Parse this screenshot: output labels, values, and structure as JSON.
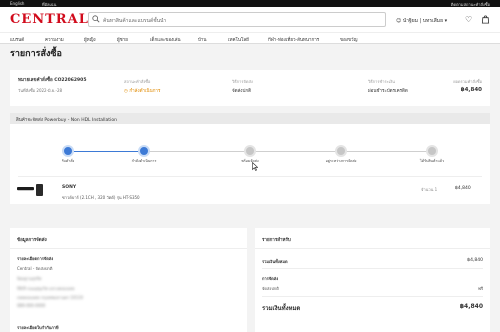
{
  "topbar": {
    "language": "English",
    "store_selector": "ที่อัลเฉน",
    "track_order": "ติดตามสถานะคำสั่งซื้อ"
  },
  "header": {
    "logo": "CENTRAL",
    "search_placeholder": "ค้นหาสินค้าและแบรนด์ชั้นนำ",
    "user_label": "นำฐิยม | บทรเสีมย"
  },
  "nav": {
    "items": [
      "แบรนด์",
      "ความงาม",
      "ผู้หญิง",
      "ผู้ชาย",
      "เด็กและของเล่น",
      "บ้าน",
      "เทคโนโลยี",
      "กีฬา-ท่องเที่ยว-สันทนาการ",
      "ของขวัญ"
    ]
  },
  "page_title": "รายการสั่งซื้อ",
  "order": {
    "number_label": "หมายเลขคำสั่งซื้อ CO22062905",
    "date": "วันที่สั่งซื้อ 2022-มิ.ย.-28",
    "status_label": "สถานะคำสั่งซื้อ",
    "status": "กำลังดำเนินการ",
    "delivery_label": "วิธีการจัดส่ง",
    "delivery": "จัดส่งปกติ",
    "payment_label": "วิธีการชำระเงิน",
    "payment": "ผ่อนชำระบัตรเครดิต",
    "total_label": "ยอดรวมคำสั่งซื้อ",
    "total": "฿4,840"
  },
  "shipment": {
    "banner": "สินค้าจะจัดส่ง Powerbuy - Non HDL Installation",
    "steps": [
      {
        "label": "รับคำสั่ง",
        "state": "done"
      },
      {
        "label": "กำลังดำเนินการ",
        "state": "done"
      },
      {
        "label": "พร้อมจัดส่ง",
        "state": "todo"
      },
      {
        "label": "อยู่ระหว่างการจัดส่ง",
        "state": "todo"
      },
      {
        "label": "ได้รับสินค้าแล้ว",
        "state": "todo"
      }
    ],
    "colors": {
      "done": "#3d7ad6",
      "todo": "#c6c6c6"
    }
  },
  "product": {
    "brand": "SONY",
    "name": "ซาวด์บาร์ (2.1CH , 320 วัตต์) รุ่น HT-S350",
    "quantity": "จำนวน 1",
    "price": "฿4,840"
  },
  "shipping_info": {
    "title": "ข้อมูลการจัดส่ง",
    "method_label": "รายละเอียดการจัดส่ง",
    "method": "Central - จัดส่งปกติ",
    "recipient_name": "นิยมฐานสุจริต",
    "address_line1": "99/9 ถนนสุขุมวิท แขวงคลองเตย",
    "address_line2": "เขตคลองเตย กรุงเทพมหานคร 10110",
    "phone": "089-000-0000",
    "tax_label": "รายละเอียดใบกำกับภาษี"
  },
  "order_summary": {
    "title": "รายการสำหรับ",
    "subtotal_label": "รวมเงินทั้งหมด",
    "subtotal": "฿4,840",
    "shipping_section": "การจัดส่ง",
    "shipping_label": "จัดส่งปกติ",
    "shipping_value": "ฟรี",
    "grand_total_label": "รวมเงินทั้งหมด",
    "grand_total": "฿4,840"
  }
}
